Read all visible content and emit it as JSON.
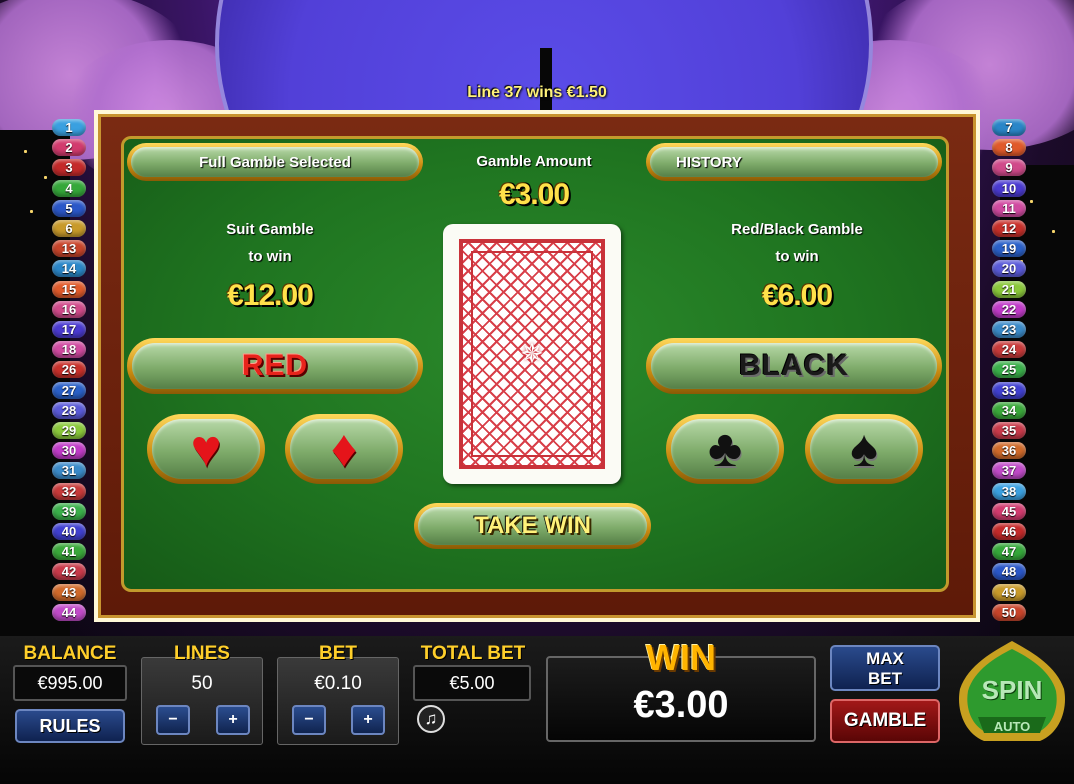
{
  "line_win_message": "Line 37 wins €1.50",
  "tabs": {
    "full_gamble": "Full Gamble Selected",
    "gamble_amount_label": "Gamble Amount",
    "history": "HISTORY"
  },
  "gamble_amount": "€3.00",
  "suit_gamble": {
    "title": "Suit Gamble",
    "subtitle": "to win",
    "amount": "€12.00"
  },
  "red_black_gamble": {
    "title": "Red/Black Gamble",
    "subtitle": "to win",
    "amount": "€6.00"
  },
  "buttons": {
    "red": "RED",
    "black": "BLACK",
    "take_win": "TAKE WIN"
  },
  "suits": {
    "hearts": "♥",
    "diamonds": "♦",
    "clubs": "♣",
    "spades": "♠"
  },
  "left_lines": [
    "1",
    "2",
    "3",
    "4",
    "5",
    "6",
    "13",
    "14",
    "15",
    "16",
    "17",
    "18",
    "26",
    "27",
    "28",
    "29",
    "30",
    "31",
    "32",
    "39",
    "40",
    "41",
    "42",
    "43",
    "44"
  ],
  "right_lines": [
    "7",
    "8",
    "9",
    "10",
    "11",
    "12",
    "19",
    "20",
    "21",
    "22",
    "23",
    "24",
    "25",
    "33",
    "34",
    "35",
    "36",
    "37",
    "38",
    "45",
    "46",
    "47",
    "48",
    "49",
    "50"
  ],
  "line_colors": [
    "#3aa0e0",
    "#d23b6e",
    "#c42a2a",
    "#35a83a",
    "#2a57c8",
    "#c89a2a",
    "#c8442a",
    "#2a86c8",
    "#e05a2a",
    "#d04a8a",
    "#4a3ad0",
    "#d04aa0",
    "#c8302a",
    "#2a60c8",
    "#5a5ad8",
    "#8ac83a",
    "#c03ac8",
    "#3a8ac8",
    "#c83a3a",
    "#3ab04a",
    "#4040d0",
    "#3aa83a",
    "#c83a4a",
    "#d06a2a",
    "#c04ac8"
  ],
  "bottom": {
    "balance_label": "BALANCE",
    "balance_value": "€995.00",
    "rules": "RULES",
    "lines_label": "LINES",
    "lines_value": "50",
    "bet_label": "BET",
    "bet_value": "€0.10",
    "total_bet_label": "TOTAL BET",
    "total_bet_value": "€5.00",
    "minus": "−",
    "plus": "+",
    "win_label": "WIN",
    "win_value": "€3.00",
    "max_bet_line1": "MAX",
    "max_bet_line2": "BET",
    "gamble": "GAMBLE",
    "spin": "SPIN",
    "auto": "AUTO",
    "music_icon": "♫"
  }
}
